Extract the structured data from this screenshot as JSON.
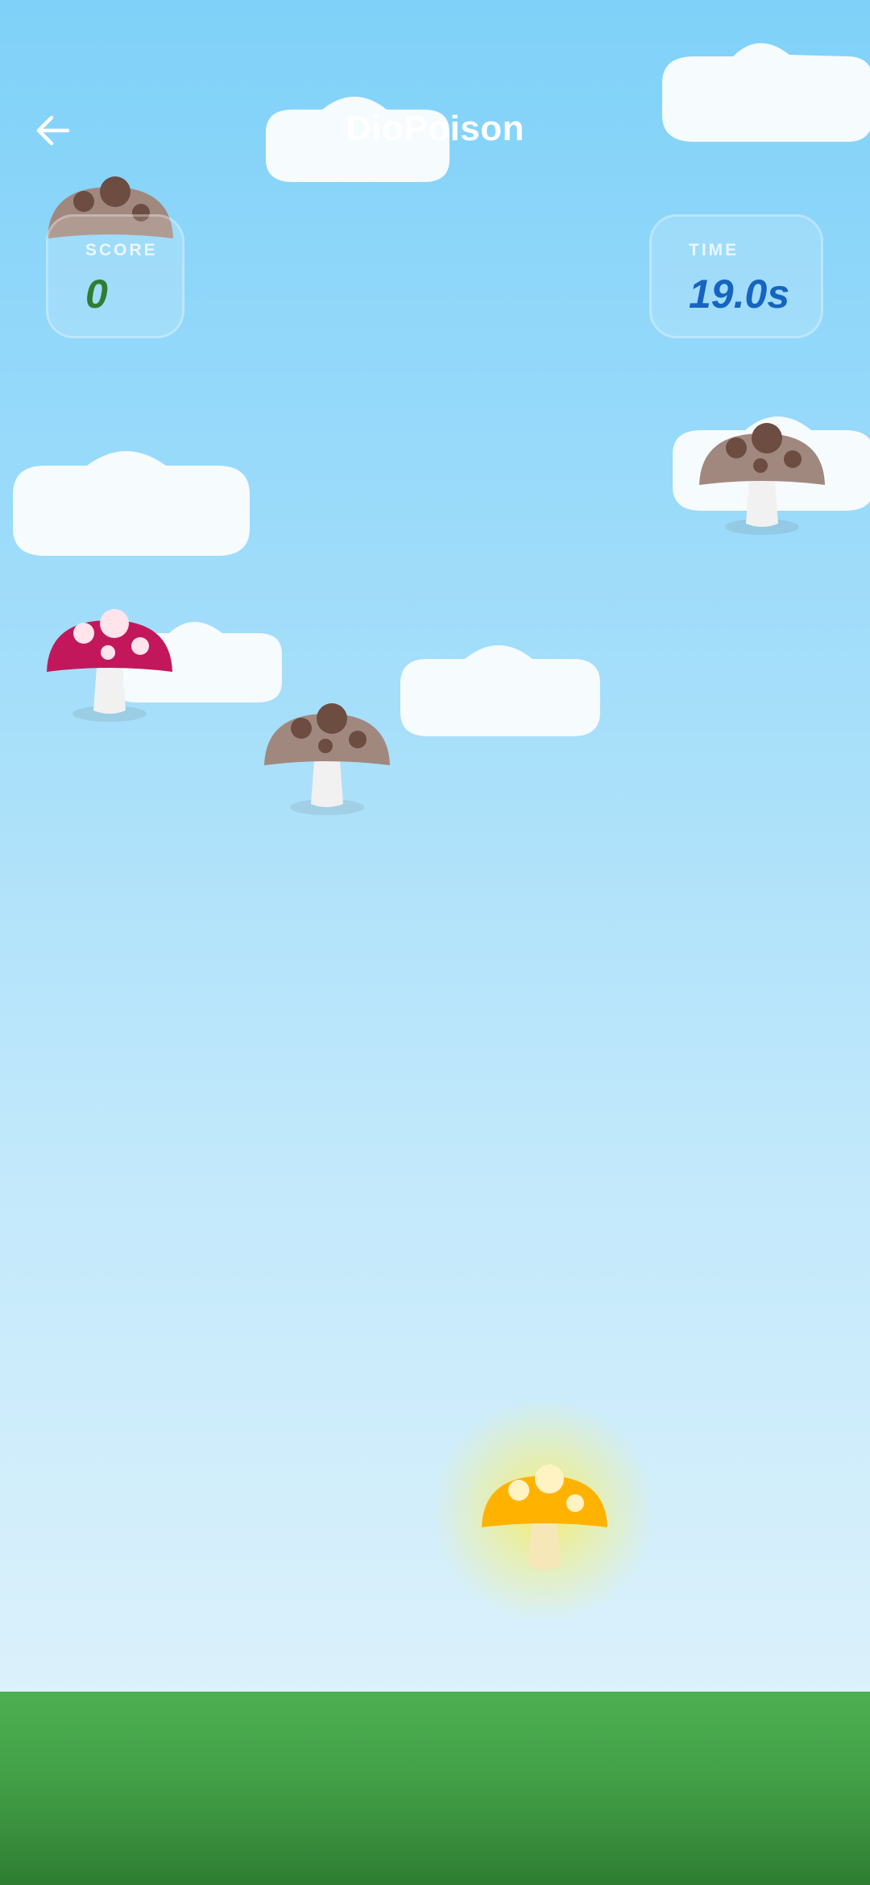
{
  "header": {
    "title": "DioPoison",
    "back_icon": "arrow-left-icon"
  },
  "hud": {
    "score_label": "SCORE",
    "score_value": "0",
    "time_label": "TIME",
    "time_value": "19.0s"
  },
  "colors": {
    "sky_top": "#7fd1f9",
    "sky_bottom": "#dbf1fb",
    "ground": "#43a047",
    "score_value": "#2e7d32",
    "time_value": "#1565c0",
    "poison_cap": "#c2185b",
    "safe_cap": "#a1887f",
    "golden_cap": "#ffb300"
  },
  "mushrooms": [
    {
      "type": "brown-spotted"
    },
    {
      "type": "brown-spotted"
    },
    {
      "type": "red-poison"
    },
    {
      "type": "brown-spotted"
    },
    {
      "type": "golden-glowing"
    }
  ]
}
